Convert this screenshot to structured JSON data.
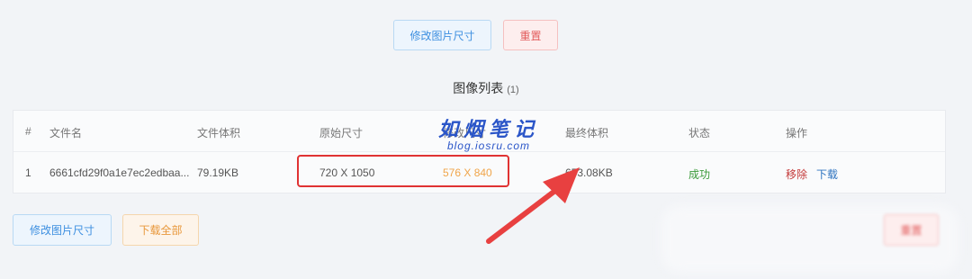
{
  "top_toolbar": {
    "resize_label": "修改图片尺寸",
    "reset_label": "重置"
  },
  "list": {
    "title": "图像列表",
    "count": "(1)"
  },
  "table": {
    "headers": [
      "#",
      "文件名",
      "文件体积",
      "原始尺寸",
      "修改尺寸",
      "最终体积",
      "状态",
      "操作"
    ],
    "rows": [
      {
        "index": "1",
        "filename": "6661cfd29f0a1e7ec2edbaa...",
        "file_size": "79.19KB",
        "original_size": "720 X 1050",
        "new_size": "576 X 840",
        "final_size": "653.08KB",
        "status": "成功",
        "remove": "移除",
        "download": "下载"
      }
    ]
  },
  "watermark": {
    "main": "如烟笔记",
    "sub": "blog.iosru.com"
  },
  "bottom_toolbar": {
    "resize_label": "修改图片尺寸",
    "download_all_label": "下载全部",
    "blurred_label": "重置"
  },
  "colors": {
    "primary": "#3d8fe0",
    "danger": "#e25b5b",
    "warning": "#e8973a",
    "success": "#3a9a3a",
    "annotation": "#e03333",
    "watermark": "#2a55c8"
  }
}
